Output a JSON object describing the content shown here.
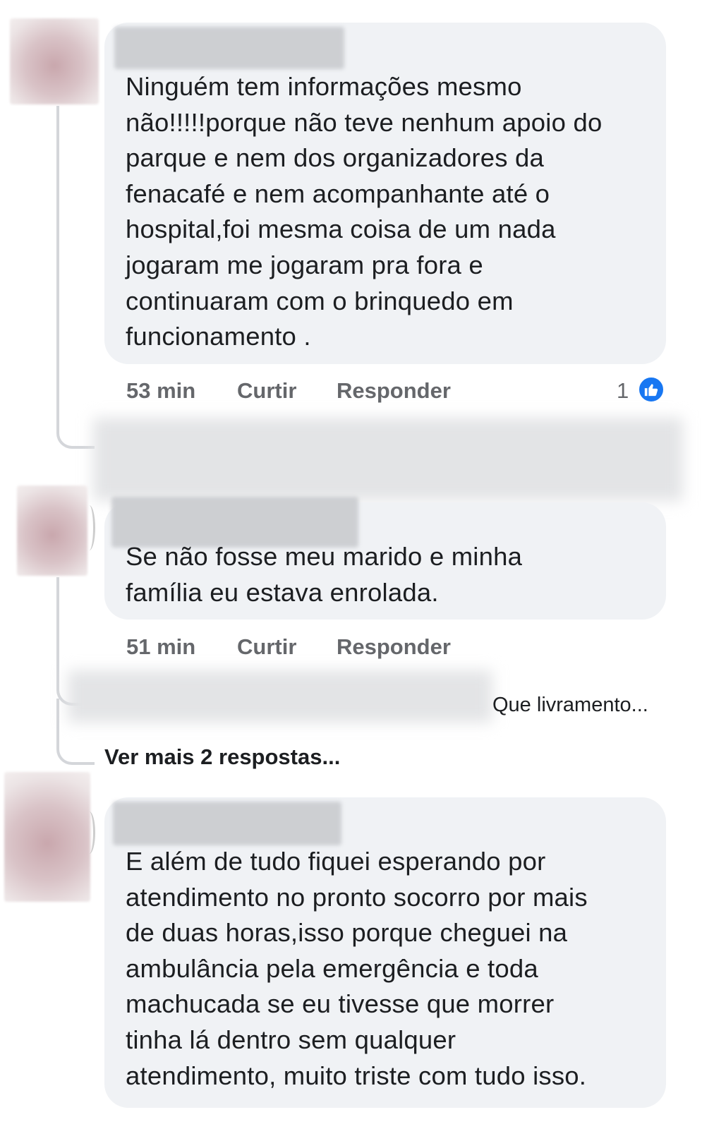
{
  "comments": [
    {
      "text": "Ninguém tem informações mesmo\nnão!!!!!porque não teve nenhum apoio do\nparque e nem dos organizadores da\nfenacafé e nem acompanhante até o\nhospital,foi mesma coisa de um nada\njogaram me jogaram pra fora e\ncontinuaram com o brinquedo em\nfuncionamento .",
      "time": "53 min",
      "like_label": "Curtir",
      "reply_label": "Responder",
      "reaction_count": "1",
      "reaction_icon": "like-icon",
      "reaction_color": "#1877f2"
    },
    {
      "text": "Se não fosse meu marido e minha\nfamília eu estava enrolada.",
      "time": "51 min",
      "like_label": "Curtir",
      "reply_label": "Responder",
      "reply_preview": "Que livramento...",
      "more_replies": "Ver mais 2 respostas..."
    },
    {
      "text": "E além de tudo fiquei esperando por\natendimento no pronto socorro por mais\nde duas horas,isso porque cheguei na\nambulância pela emergência e toda\nmachucada se eu tivesse que morrer\ntinha lá dentro sem qualquer\natendimento, muito triste com tudo isso."
    }
  ],
  "colors": {
    "bubble": "#f0f2f5",
    "meta_text": "#65676b",
    "thread_line": "#d4d6da"
  }
}
